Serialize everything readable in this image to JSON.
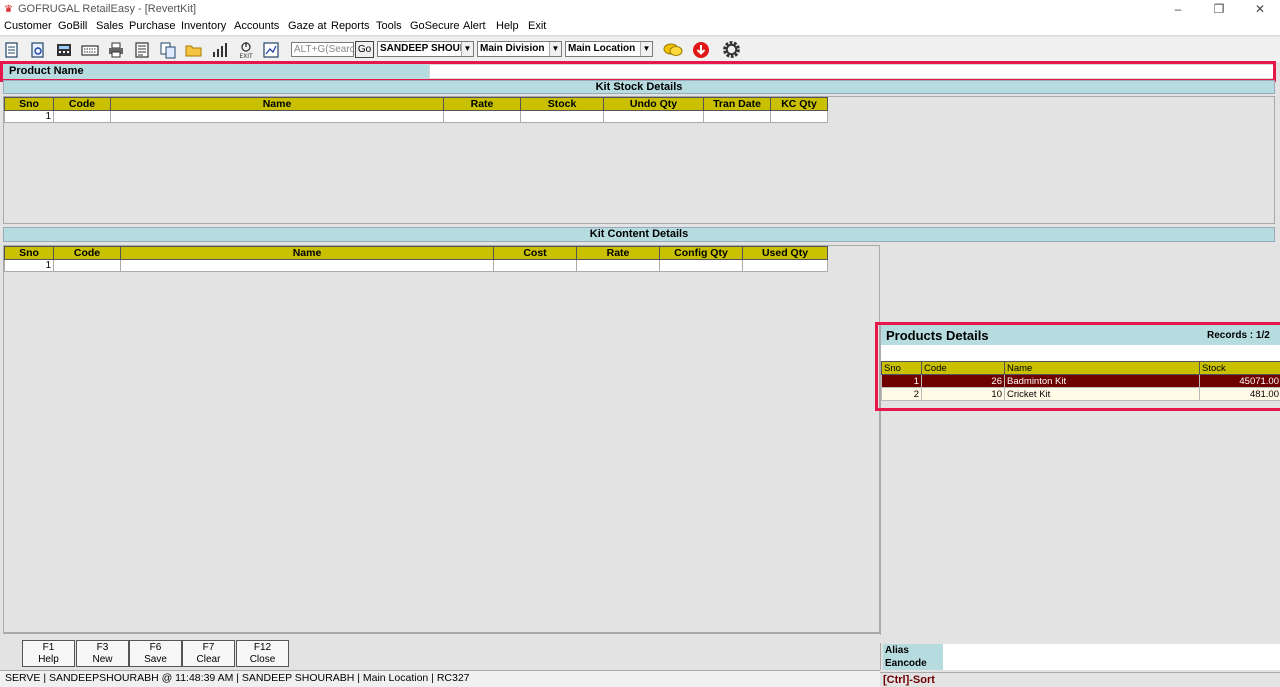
{
  "window": {
    "title": "GOFRUGAL RetailEasy - [RevertKit]"
  },
  "menu": [
    "Customer",
    "GoBill",
    "Sales",
    "Purchase",
    "Inventory",
    "Accounts",
    "Gaze at",
    "Reports",
    "Tools",
    "GoSecure",
    "Alert",
    "Help",
    "Exit"
  ],
  "toolbar": {
    "search_placeholder": "ALT+G(Search)",
    "go_label": "Go",
    "user_combo": "SANDEEP SHOURA",
    "division_combo": "Main Division",
    "location_combo": "Main Location"
  },
  "product_name_label": "Product Name",
  "kit_stock": {
    "title": "Kit Stock Details",
    "columns": [
      "Sno",
      "Code",
      "Name",
      "Rate",
      "Stock",
      "Undo Qty",
      "Tran Date",
      "KC Qty"
    ],
    "rows": [
      [
        "1",
        "",
        "",
        "",
        "",
        "",
        "",
        ""
      ]
    ]
  },
  "kit_content": {
    "title": "Kit Content Details",
    "columns": [
      "Sno",
      "Code",
      "Name",
      "Cost",
      "Rate",
      "Config Qty",
      "Used Qty"
    ],
    "rows": [
      [
        "1",
        "",
        "",
        "",
        "",
        "",
        ""
      ]
    ]
  },
  "products_details": {
    "title": "Products Details",
    "records": "Records : 1/2",
    "columns": [
      "Sno",
      "Code",
      "Name",
      "Stock"
    ],
    "rows": [
      [
        "1",
        "26",
        "Badminton Kit",
        "45071.00"
      ],
      [
        "2",
        "10",
        "Cricket Kit",
        "481.00"
      ]
    ]
  },
  "fkeys": [
    {
      "key": "F1",
      "label": "Help"
    },
    {
      "key": "F3",
      "label": "New"
    },
    {
      "key": "F6",
      "label": "Save"
    },
    {
      "key": "F7",
      "label": "Clear"
    },
    {
      "key": "F12",
      "label": "Close"
    }
  ],
  "alias": {
    "alias_label": "Alias",
    "eancode_label": "Eancode"
  },
  "status": "SERVE | SANDEEPSHOURABH  @ 11:48:39 AM   | SANDEEP SHOURABH   | Main Location | RC327",
  "sort_hint": "[Ctrl]-Sort",
  "accent": {
    "highlight": "#e8174b",
    "grid_header": "#c8c000",
    "section": "#b6dce0",
    "selected_row": "#6e0000"
  }
}
